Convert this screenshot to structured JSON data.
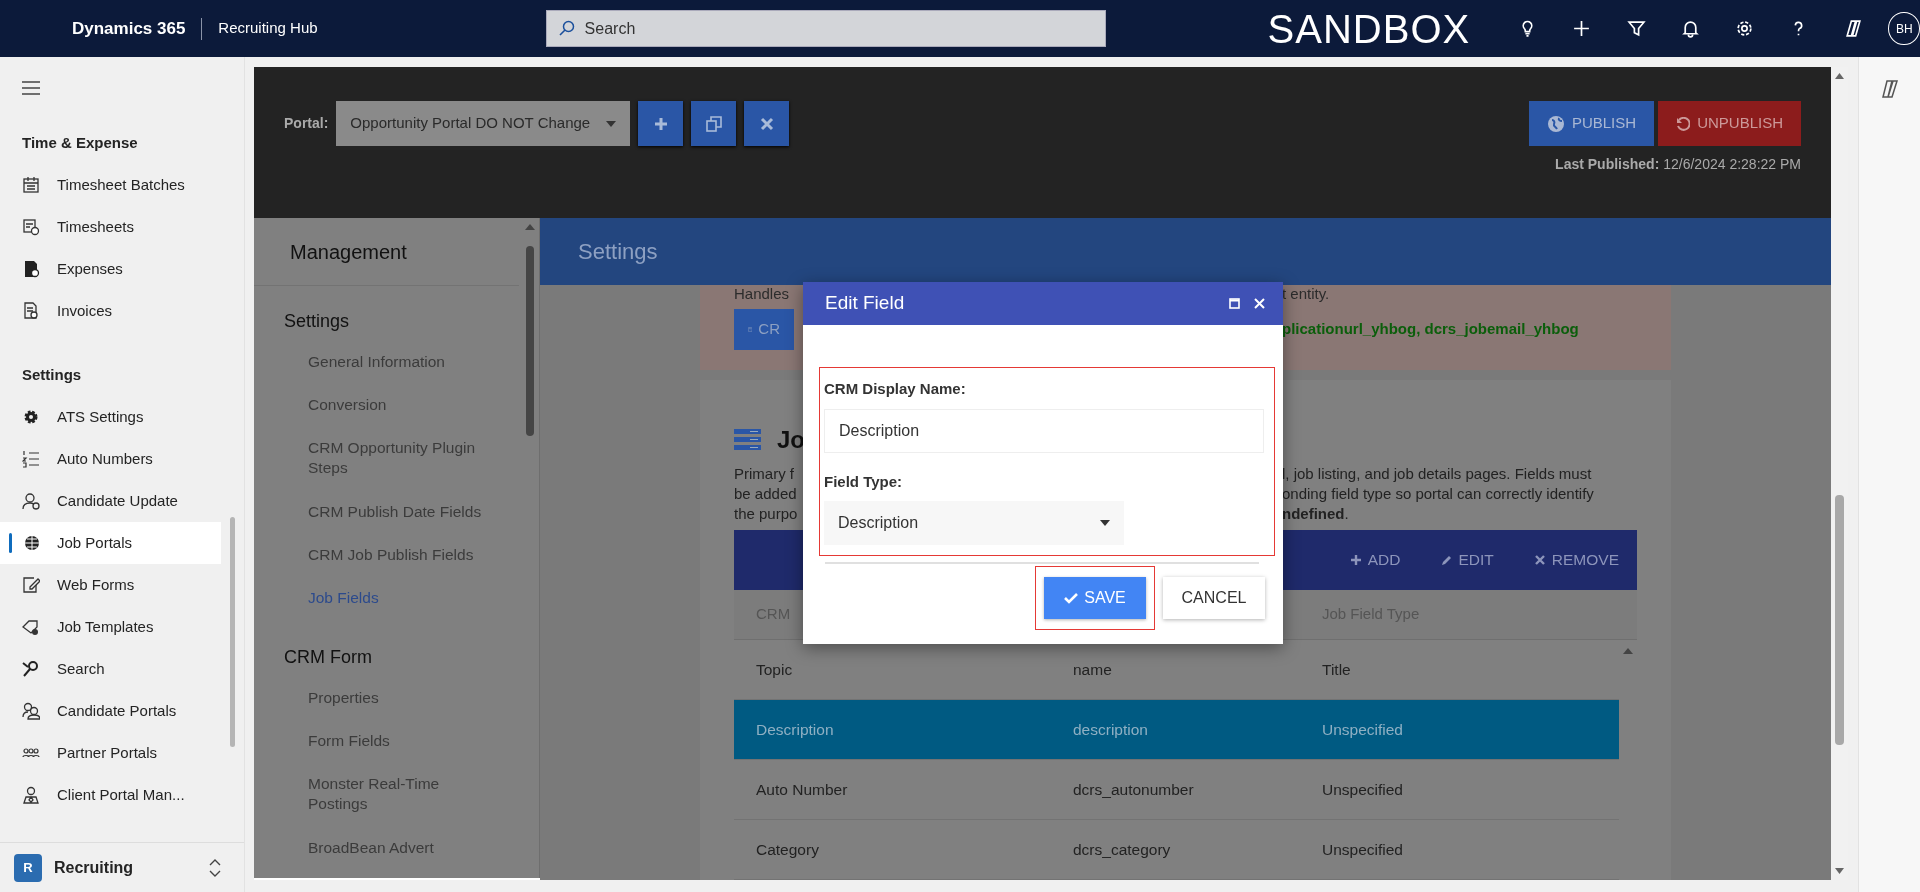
{
  "topbar": {
    "app_name": "Dynamics 365",
    "area": "Recruiting Hub",
    "search": {
      "placeholder": "Search"
    },
    "environment": "SANDBOX",
    "avatar": "BH"
  },
  "sidebar": {
    "groups": [
      {
        "title": "Time & Expense",
        "items": [
          {
            "label": "Timesheet Batches",
            "selected": false
          },
          {
            "label": "Timesheets",
            "selected": false
          },
          {
            "label": "Expenses",
            "selected": false
          },
          {
            "label": "Invoices",
            "selected": false
          }
        ]
      },
      {
        "title": "Settings",
        "items": [
          {
            "label": "ATS Settings",
            "selected": false
          },
          {
            "label": "Auto Numbers",
            "selected": false
          },
          {
            "label": "Candidate Update",
            "selected": false
          },
          {
            "label": "Job Portals",
            "selected": true
          },
          {
            "label": "Web Forms",
            "selected": false
          },
          {
            "label": "Job Templates",
            "selected": false
          },
          {
            "label": "Search",
            "selected": false
          },
          {
            "label": "Candidate Portals",
            "selected": false
          },
          {
            "label": "Partner Portals",
            "selected": false
          },
          {
            "label": "Client Portal Man...",
            "selected": false
          }
        ]
      }
    ],
    "area_switcher": {
      "badge": "R",
      "label": "Recruiting"
    }
  },
  "portal_header": {
    "portal_label": "Portal:",
    "portal": "Opportunity Portal DO NOT Change",
    "publish": "PUBLISH",
    "unpublish": "UNPUBLISH",
    "last_published_label": "Last Published:",
    "last_published": "12/6/2024 2:28:22 PM"
  },
  "management": {
    "title": "Management",
    "sections": [
      {
        "title": "Settings",
        "items": [
          {
            "label": "General Information",
            "selected": false
          },
          {
            "label": "Conversion",
            "selected": false
          },
          {
            "label": "CRM Opportunity Plugin Steps",
            "selected": false
          },
          {
            "label": "CRM Publish Date Fields",
            "selected": false
          },
          {
            "label": "CRM Job Publish Fields",
            "selected": false
          },
          {
            "label": "Job Fields",
            "selected": true
          }
        ]
      },
      {
        "title": "CRM Form",
        "items": [
          {
            "label": "Properties",
            "selected": false
          },
          {
            "label": "Form Fields",
            "selected": false
          },
          {
            "label": "Monster Real-Time Postings",
            "selected": false
          },
          {
            "label": "BroadBean Advert",
            "selected": false
          }
        ]
      }
    ]
  },
  "settings_bar": {
    "title": "Settings"
  },
  "notice": {
    "text_left": "Handles",
    "text_right": "t entity.",
    "button": "CR",
    "fields": "plicationurl_yhbog, dcrs_jobemail_yhbog"
  },
  "job_fields": {
    "title": "Jo",
    "description_lines": [
      {
        "left": "Primary f",
        "right": "l, job listing, and job details pages. Fields must"
      },
      {
        "left": "be added",
        "right": "onding field type so portal can correctly identify"
      },
      {
        "left": "the purpo",
        "right": "**ndefined**."
      }
    ],
    "toolbar": [
      "ADD",
      "EDIT",
      "REMOVE"
    ],
    "columns": {
      "column_1": "CRM",
      "column_3": "Job Field Type"
    },
    "rows": [
      {
        "cells": [
          "Topic",
          "name",
          "Title"
        ],
        "selected": false
      },
      {
        "cells": [
          "Description",
          "description",
          "Unspecified"
        ],
        "selected": true
      },
      {
        "cells": [
          "Auto Number",
          "dcrs_autonumber",
          "Unspecified"
        ],
        "selected": false
      },
      {
        "cells": [
          "Category",
          "dcrs_category",
          "Unspecified"
        ],
        "selected": false
      }
    ]
  },
  "dialog": {
    "title": "Edit Field",
    "fields": [
      {
        "label": "CRM Display Name:",
        "kind": "text",
        "value": "Description"
      },
      {
        "label": "Field Type:",
        "kind": "select",
        "value": "Description"
      }
    ],
    "save": "SAVE",
    "cancel": "CANCEL"
  }
}
